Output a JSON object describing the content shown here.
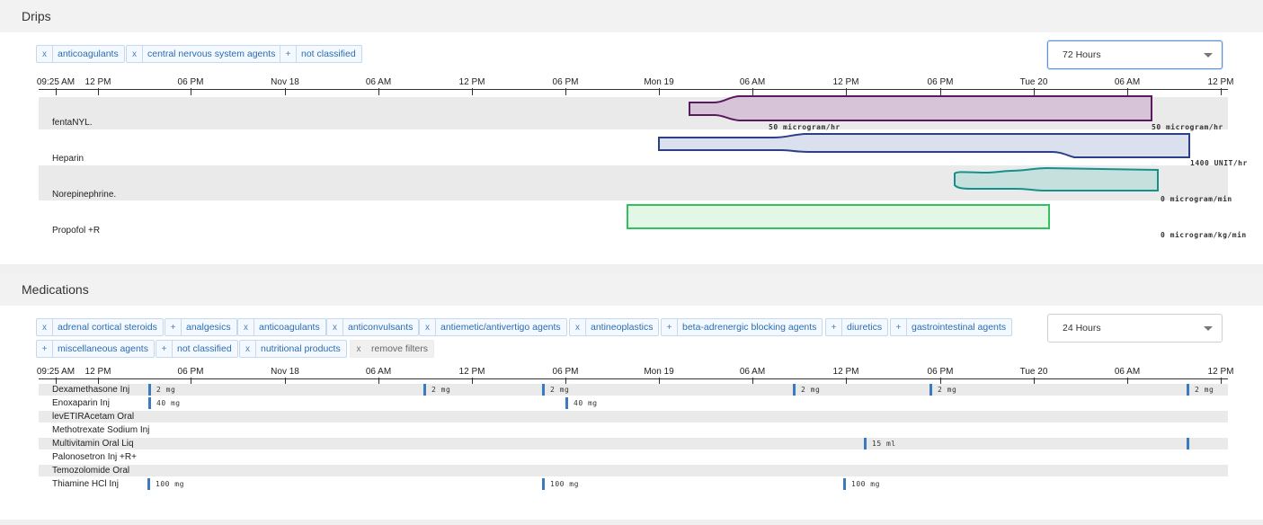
{
  "drips": {
    "title": "Drips",
    "filters": [
      {
        "icon": "x",
        "label": "anticoagulants",
        "active": true
      },
      {
        "icon": "x",
        "label": "central nervous system agents",
        "active": true
      },
      {
        "icon": "+",
        "label": "not classified",
        "active": false
      }
    ],
    "range_select": {
      "value": "72 Hours"
    },
    "axis_ticks": [
      "09:25 AM",
      "12 PM",
      "06 PM",
      "Nov 18",
      "06 AM",
      "12 PM",
      "06 PM",
      "Mon 19",
      "06 AM",
      "12 PM",
      "06 PM",
      "Tue 20",
      "06 AM",
      "12 PM"
    ],
    "rows": [
      {
        "name": "fentaNYL.",
        "color": "#5a1a5e",
        "fill": "#d8c4d8",
        "rates": [
          "50 microgram/hr",
          "50 microgram/hr"
        ]
      },
      {
        "name": "Heparin",
        "color": "#2d3f86",
        "fill": "#dbe0ee",
        "rates": [
          "1400 UNIT/hr"
        ]
      },
      {
        "name": "Norepinephrine.",
        "color": "#17908a",
        "fill": "#c5e0dd",
        "rates": [
          "0 microgram/min"
        ]
      },
      {
        "name": "Propofol +R",
        "color": "#33c160",
        "fill": "#e2f7e6",
        "rates": [
          "0 microgram/kg/min"
        ]
      }
    ]
  },
  "medications": {
    "title": "Medications",
    "filters": [
      {
        "icon": "x",
        "label": "adrenal cortical steroids",
        "active": true
      },
      {
        "icon": "+",
        "label": "analgesics",
        "active": false
      },
      {
        "icon": "x",
        "label": "anticoagulants",
        "active": true
      },
      {
        "icon": "x",
        "label": "anticonvulsants",
        "active": true
      },
      {
        "icon": "x",
        "label": "antiemetic/antivertigo agents",
        "active": true
      },
      {
        "icon": "x",
        "label": "antineoplastics",
        "active": true
      },
      {
        "icon": "+",
        "label": "beta-adrenergic blocking agents",
        "active": false
      },
      {
        "icon": "+",
        "label": "diuretics",
        "active": false
      },
      {
        "icon": "+",
        "label": "gastrointestinal agents",
        "active": false
      },
      {
        "icon": "+",
        "label": "miscellaneous agents",
        "active": false
      },
      {
        "icon": "+",
        "label": "not classified",
        "active": false
      },
      {
        "icon": "x",
        "label": "nutritional products",
        "active": true
      }
    ],
    "remove_filters": {
      "icon": "x",
      "label": "remove filters"
    },
    "range_select": {
      "value": "24 Hours"
    },
    "axis_ticks": [
      "09:25 AM",
      "12 PM",
      "06 PM",
      "Nov 18",
      "06 AM",
      "12 PM",
      "06 PM",
      "Mon 19",
      "06 AM",
      "12 PM",
      "06 PM",
      "Tue 20",
      "06 AM",
      "12 PM"
    ],
    "rows": [
      {
        "name": "Dexamethasone Inj",
        "doses": [
          "2 mg",
          "2 mg",
          "2 mg",
          "2 mg",
          "2 mg",
          "2 mg"
        ]
      },
      {
        "name": "Enoxaparin Inj",
        "doses": [
          "40 mg",
          "40 mg"
        ]
      },
      {
        "name": "levETIRAcetam Oral",
        "doses": []
      },
      {
        "name": "Methotrexate Sodium Inj",
        "doses": []
      },
      {
        "name": "Multivitamin Oral Liq",
        "doses": [
          "15 ml",
          ""
        ]
      },
      {
        "name": "Palonosetron Inj +R+",
        "doses": []
      },
      {
        "name": "Temozolomide Oral",
        "doses": []
      },
      {
        "name": "Thiamine HCl Inj",
        "doses": [
          "100 mg",
          "100 mg",
          "100 mg"
        ]
      }
    ]
  }
}
